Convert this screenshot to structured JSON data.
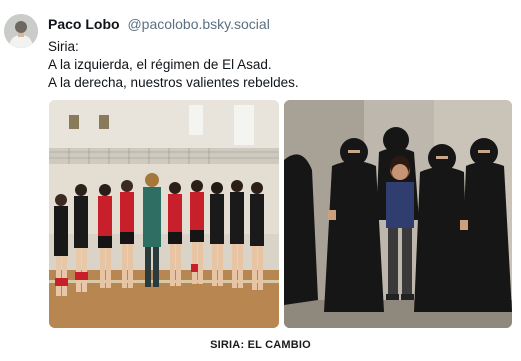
{
  "post": {
    "author_name": "Paco Lobo",
    "author_handle": "@pacolobo.bsky.social",
    "text_lines": [
      "Siria:",
      "A la izquierda, el régimen de El Asad.",
      "A la derecha, nuestros valientes rebeldes."
    ],
    "media": [
      {
        "icon": "photo-volleyball-team",
        "alt": ""
      },
      {
        "icon": "photo-women-in-niqab",
        "alt": ""
      }
    ],
    "caption": "SIRIA: EL CAMBIO"
  },
  "colors": {
    "text": "#0f1419",
    "handle": "#5b7083",
    "jersey_red": "#c8202a",
    "niqab_black": "#161616"
  }
}
